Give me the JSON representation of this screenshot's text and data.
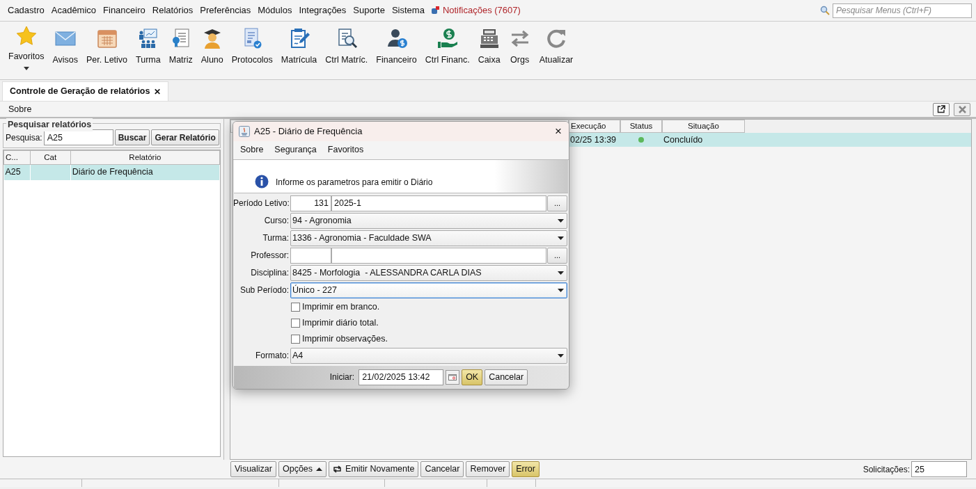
{
  "menu": [
    {
      "label": "Cadastro"
    },
    {
      "label": "Acadêmico"
    },
    {
      "label": "Financeiro"
    },
    {
      "label": "Relatórios"
    },
    {
      "label": "Preferências"
    },
    {
      "label": "Módulos"
    },
    {
      "label": "Integrações"
    },
    {
      "label": "Suporte"
    },
    {
      "label": "Sistema"
    }
  ],
  "notifications": {
    "label": "Notificações (7607)"
  },
  "menu_search": {
    "placeholder": "Pesquisar Menus (Ctrl+F)"
  },
  "toolbar": [
    {
      "label": "Favoritos",
      "dropdown": true
    },
    {
      "label": "Avisos",
      "dropdown": false
    },
    {
      "label": "Per. Letivo",
      "dropdown": false
    },
    {
      "label": "Turma",
      "dropdown": false
    },
    {
      "label": "Matriz",
      "dropdown": false
    },
    {
      "label": "Aluno",
      "dropdown": false
    },
    {
      "label": "Protocolos",
      "dropdown": false
    },
    {
      "label": "Matrícula",
      "dropdown": false
    },
    {
      "label": "Ctrl Matríc.",
      "dropdown": false
    },
    {
      "label": "Financeiro",
      "dropdown": false
    },
    {
      "label": "Ctrl Financ.",
      "dropdown": false
    },
    {
      "label": "Caixa",
      "dropdown": false
    },
    {
      "label": "Orgs",
      "dropdown": false
    },
    {
      "label": "Atualizar",
      "dropdown": false
    }
  ],
  "tabs": [
    {
      "label": "Controle de Geração de relatórios",
      "close": "✕",
      "selected": true
    }
  ],
  "sub_menu": [
    {
      "label": "Sobre"
    }
  ],
  "search_panel": {
    "title": "Pesquisar relatórios",
    "label": "Pesquisa:",
    "value": "A25",
    "buttons": [
      "Buscar",
      "Gerar Relatório"
    ]
  },
  "reports_table": {
    "columns": [
      "C...",
      "Cat",
      "Relatório"
    ],
    "rows": [
      {
        "cells": [
          "A25",
          "",
          "Diário de Frequência"
        ],
        "selected": true
      }
    ]
  },
  "requests_table": {
    "columns": [
      "Execução",
      "Status",
      "Situação"
    ],
    "rows": [
      {
        "execucao": "02/25 13:39",
        "color": "#5cb85c",
        "situacao": "Concluído",
        "selected": true
      }
    ]
  },
  "dialog": {
    "title": "A25 - Diário de Frequência",
    "close": "×",
    "menu": [
      "Sobre",
      "Segurança",
      "Favoritos"
    ],
    "info": "Informe os parametros para emitir o Diário",
    "fields": [
      {
        "kind": "lookup",
        "label": "Período Letivo:",
        "code": "131",
        "value": "2025-1",
        "button": "..."
      },
      {
        "kind": "select",
        "label": "Curso:",
        "value": "94 - Agronomia",
        "focused": false
      },
      {
        "kind": "select",
        "label": "Turma:",
        "value": "1336 - Agronomia - Faculdade SWA",
        "focused": false
      },
      {
        "kind": "lookup",
        "label": "Professor:",
        "button": "..."
      },
      {
        "kind": "select",
        "label": "Disciplina:",
        "value": "8425 - Morfologia  - ALESSANDRA CARLA DIAS",
        "focused": false
      },
      {
        "kind": "select",
        "label": "Sub Período:",
        "value": "Único - 227",
        "focused": true
      },
      {
        "kind": "checkbox",
        "label": "Imprimir em branco.",
        "checked": false
      },
      {
        "kind": "checkbox",
        "label": "Imprimir diário total.",
        "checked": false
      },
      {
        "kind": "checkbox",
        "label": "Imprimir observações.",
        "checked": false
      },
      {
        "kind": "select",
        "label": "Formato:",
        "value": "A4",
        "focused": false
      }
    ],
    "footer": {
      "label": "Iniciar:",
      "value": "21/02/2025 13:42",
      "buttons": [
        {
          "label": "OK",
          "highlighted": true
        },
        {
          "label": "Cancelar",
          "highlighted": false
        }
      ]
    }
  },
  "actions": [
    {
      "label": "Visualizar",
      "kind": "plain",
      "highlighted": false
    },
    {
      "label": "Opções",
      "kind": "menu",
      "highlighted": false
    },
    {
      "label": "Emitir Novamente",
      "kind": "reissue",
      "highlighted": false
    },
    {
      "label": "Cancelar",
      "kind": "plain",
      "highlighted": false
    },
    {
      "label": "Remover",
      "kind": "plain",
      "highlighted": false
    },
    {
      "label": "Error",
      "kind": "plain",
      "highlighted": true
    }
  ],
  "requests_count": {
    "label": "Solicitações:",
    "value": "25"
  }
}
